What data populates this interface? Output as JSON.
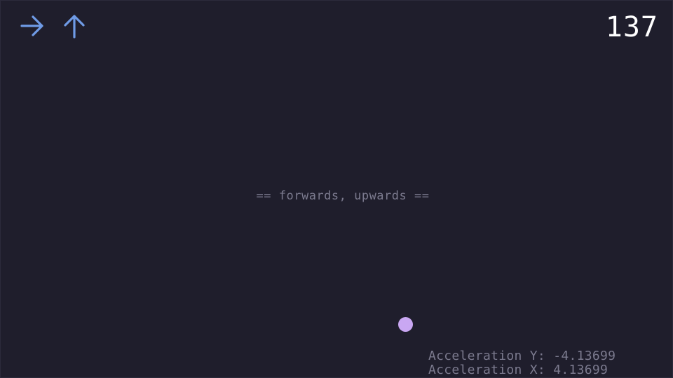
{
  "hud": {
    "arrows": [
      {
        "direction": "right",
        "icon": "arrow-right-icon",
        "color": "#6f9be6"
      },
      {
        "direction": "up",
        "icon": "arrow-up-icon",
        "color": "#6f9be6"
      }
    ],
    "score": "137"
  },
  "instruction": "== forwards, upwards ==",
  "player": {
    "icon": "ball-icon",
    "color": "#c9a7f2"
  },
  "debug": {
    "acceleration_y": "Acceleration Y: -4.13699",
    "acceleration_x": "Acceleration X: 4.13699"
  },
  "colors": {
    "background": "#1f1e2c",
    "text_dim": "#7b7a8e",
    "score": "#ffffff"
  }
}
